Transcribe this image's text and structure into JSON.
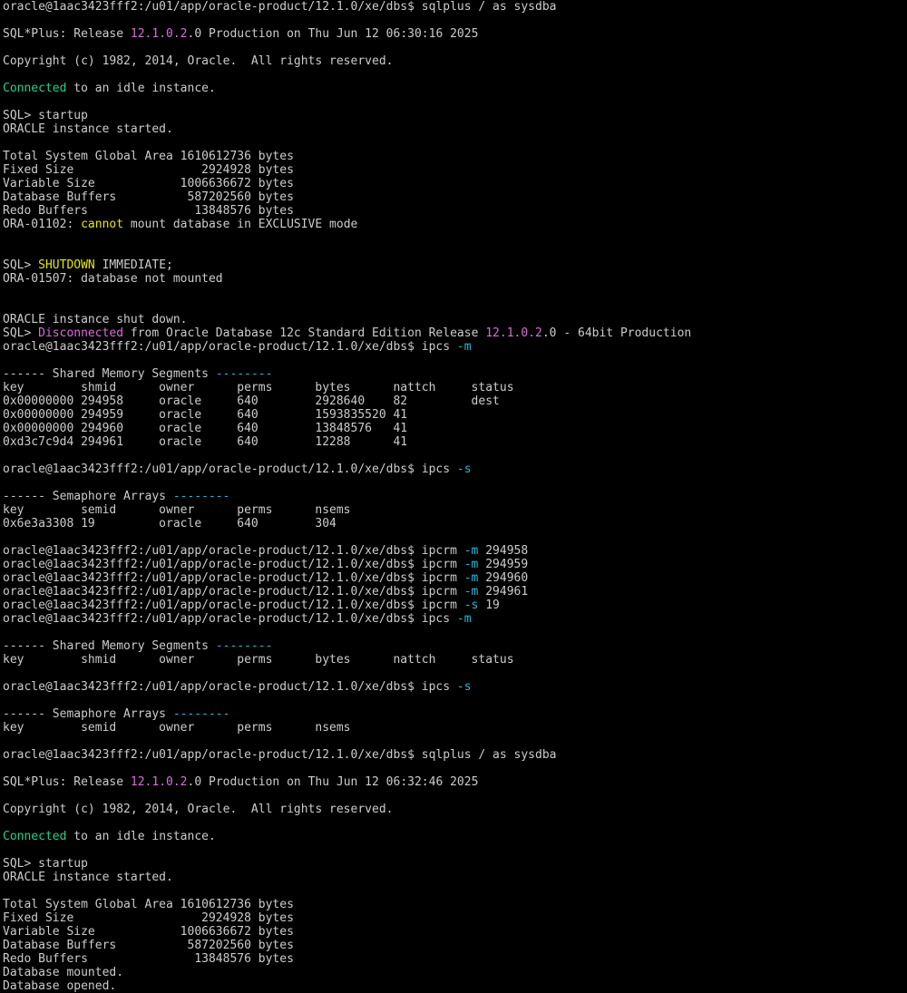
{
  "terminal": {
    "colors": {
      "background": "#000000",
      "default": "#cccccc",
      "magenta": "#d670d6",
      "green": "#23d18b",
      "yellow": "#e5e510",
      "cyan": "#29b8db"
    },
    "lines": [
      [
        {
          "text": "oracle@1aac3423fff2:/u01/app/oracle-product/12.1.0/xe/dbs$ sqlplus / as sysdba",
          "color": "default"
        }
      ],
      [],
      [
        {
          "text": "SQL*Plus: Release ",
          "color": "default"
        },
        {
          "text": "12.1.0.2",
          "color": "magenta"
        },
        {
          "text": ".0 Production on Thu Jun 12 06:30:16 2025",
          "color": "default"
        }
      ],
      [],
      [
        {
          "text": "Copyright (c) 1982, 2014, Oracle.  All rights reserved.",
          "color": "default"
        }
      ],
      [],
      [
        {
          "text": "Connected",
          "color": "green"
        },
        {
          "text": " to an idle instance.",
          "color": "default"
        }
      ],
      [],
      [
        {
          "text": "SQL> startup",
          "color": "default"
        }
      ],
      [
        {
          "text": "ORACLE instance started.",
          "color": "default"
        }
      ],
      [],
      [
        {
          "text": "Total System Global Area 1610612736 bytes",
          "color": "default"
        }
      ],
      [
        {
          "text": "Fixed Size                  2924928 bytes",
          "color": "default"
        }
      ],
      [
        {
          "text": "Variable Size            1006636672 bytes",
          "color": "default"
        }
      ],
      [
        {
          "text": "Database Buffers          587202560 bytes",
          "color": "default"
        }
      ],
      [
        {
          "text": "Redo Buffers               13848576 bytes",
          "color": "default"
        }
      ],
      [
        {
          "text": "ORA-01102: ",
          "color": "default"
        },
        {
          "text": "cannot",
          "color": "yellow"
        },
        {
          "text": " mount database in EXCLUSIVE mode",
          "color": "default"
        }
      ],
      [],
      [],
      [
        {
          "text": "SQL> ",
          "color": "default"
        },
        {
          "text": "SHUTDOWN",
          "color": "yellow"
        },
        {
          "text": " IMMEDIATE;",
          "color": "default"
        }
      ],
      [
        {
          "text": "ORA-01507: database not mounted",
          "color": "default"
        }
      ],
      [],
      [],
      [
        {
          "text": "ORACLE instance shut down.",
          "color": "default"
        }
      ],
      [
        {
          "text": "SQL> ",
          "color": "default"
        },
        {
          "text": "Disconnected",
          "color": "magenta"
        },
        {
          "text": " from Oracle Database 12c Standard Edition Release ",
          "color": "default"
        },
        {
          "text": "12.1.0.2",
          "color": "magenta"
        },
        {
          "text": ".0 - 64bit Production",
          "color": "default"
        }
      ],
      [
        {
          "text": "oracle@1aac3423fff2:/u01/app/oracle-product/12.1.0/xe/dbs$ ipcs ",
          "color": "default"
        },
        {
          "text": "-m",
          "color": "cyan"
        }
      ],
      [],
      [
        {
          "text": "------ Shared Memory Segments ",
          "color": "default"
        },
        {
          "text": "--------",
          "color": "cyan"
        }
      ],
      [
        {
          "text": "key        shmid      owner      perms      bytes      nattch     status",
          "color": "default"
        }
      ],
      [
        {
          "text": "0x00000000 294958     oracle     640        2928640    82         dest",
          "color": "default"
        }
      ],
      [
        {
          "text": "0x00000000 294959     oracle     640        1593835520 41",
          "color": "default"
        }
      ],
      [
        {
          "text": "0x00000000 294960     oracle     640        13848576   41",
          "color": "default"
        }
      ],
      [
        {
          "text": "0xd3c7c9d4 294961     oracle     640        12288      41",
          "color": "default"
        }
      ],
      [],
      [
        {
          "text": "oracle@1aac3423fff2:/u01/app/oracle-product/12.1.0/xe/dbs$ ipcs ",
          "color": "default"
        },
        {
          "text": "-s",
          "color": "cyan"
        }
      ],
      [],
      [
        {
          "text": "------ Semaphore Arrays ",
          "color": "default"
        },
        {
          "text": "--------",
          "color": "cyan"
        }
      ],
      [
        {
          "text": "key        semid      owner      perms      nsems",
          "color": "default"
        }
      ],
      [
        {
          "text": "0x6e3a3308 19         oracle     640        304",
          "color": "default"
        }
      ],
      [],
      [
        {
          "text": "oracle@1aac3423fff2:/u01/app/oracle-product/12.1.0/xe/dbs$ ipcrm ",
          "color": "default"
        },
        {
          "text": "-m",
          "color": "cyan"
        },
        {
          "text": " 294958",
          "color": "default"
        }
      ],
      [
        {
          "text": "oracle@1aac3423fff2:/u01/app/oracle-product/12.1.0/xe/dbs$ ipcrm ",
          "color": "default"
        },
        {
          "text": "-m",
          "color": "cyan"
        },
        {
          "text": " 294959",
          "color": "default"
        }
      ],
      [
        {
          "text": "oracle@1aac3423fff2:/u01/app/oracle-product/12.1.0/xe/dbs$ ipcrm ",
          "color": "default"
        },
        {
          "text": "-m",
          "color": "cyan"
        },
        {
          "text": " 294960",
          "color": "default"
        }
      ],
      [
        {
          "text": "oracle@1aac3423fff2:/u01/app/oracle-product/12.1.0/xe/dbs$ ipcrm ",
          "color": "default"
        },
        {
          "text": "-m",
          "color": "cyan"
        },
        {
          "text": " 294961",
          "color": "default"
        }
      ],
      [
        {
          "text": "oracle@1aac3423fff2:/u01/app/oracle-product/12.1.0/xe/dbs$ ipcrm ",
          "color": "default"
        },
        {
          "text": "-s",
          "color": "cyan"
        },
        {
          "text": " 19",
          "color": "default"
        }
      ],
      [
        {
          "text": "oracle@1aac3423fff2:/u01/app/oracle-product/12.1.0/xe/dbs$ ipcs ",
          "color": "default"
        },
        {
          "text": "-m",
          "color": "cyan"
        }
      ],
      [],
      [
        {
          "text": "------ Shared Memory Segments ",
          "color": "default"
        },
        {
          "text": "--------",
          "color": "cyan"
        }
      ],
      [
        {
          "text": "key        shmid      owner      perms      bytes      nattch     status",
          "color": "default"
        }
      ],
      [],
      [
        {
          "text": "oracle@1aac3423fff2:/u01/app/oracle-product/12.1.0/xe/dbs$ ipcs ",
          "color": "default"
        },
        {
          "text": "-s",
          "color": "cyan"
        }
      ],
      [],
      [
        {
          "text": "------ Semaphore Arrays ",
          "color": "default"
        },
        {
          "text": "--------",
          "color": "cyan"
        }
      ],
      [
        {
          "text": "key        semid      owner      perms      nsems",
          "color": "default"
        }
      ],
      [],
      [
        {
          "text": "oracle@1aac3423fff2:/u01/app/oracle-product/12.1.0/xe/dbs$ sqlplus / as sysdba",
          "color": "default"
        }
      ],
      [],
      [
        {
          "text": "SQL*Plus: Release ",
          "color": "default"
        },
        {
          "text": "12.1.0.2",
          "color": "magenta"
        },
        {
          "text": ".0 Production on Thu Jun 12 06:32:46 2025",
          "color": "default"
        }
      ],
      [],
      [
        {
          "text": "Copyright (c) 1982, 2014, Oracle.  All rights reserved.",
          "color": "default"
        }
      ],
      [],
      [
        {
          "text": "Connected",
          "color": "green"
        },
        {
          "text": " to an idle instance.",
          "color": "default"
        }
      ],
      [],
      [
        {
          "text": "SQL> startup",
          "color": "default"
        }
      ],
      [
        {
          "text": "ORACLE instance started.",
          "color": "default"
        }
      ],
      [],
      [
        {
          "text": "Total System Global Area 1610612736 bytes",
          "color": "default"
        }
      ],
      [
        {
          "text": "Fixed Size                  2924928 bytes",
          "color": "default"
        }
      ],
      [
        {
          "text": "Variable Size            1006636672 bytes",
          "color": "default"
        }
      ],
      [
        {
          "text": "Database Buffers          587202560 bytes",
          "color": "default"
        }
      ],
      [
        {
          "text": "Redo Buffers               13848576 bytes",
          "color": "default"
        }
      ],
      [
        {
          "text": "Database mounted.",
          "color": "default"
        }
      ],
      [
        {
          "text": "Database opened.",
          "color": "default"
        }
      ]
    ]
  }
}
